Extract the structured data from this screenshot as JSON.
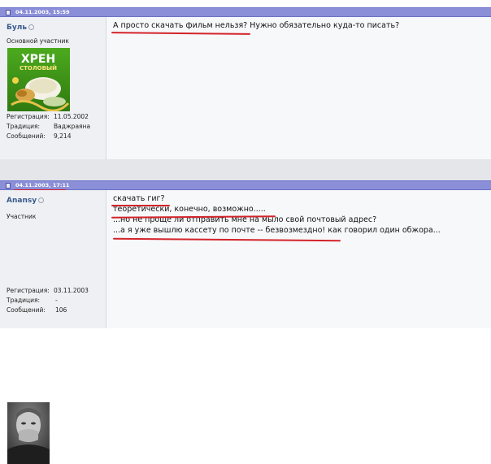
{
  "posts": [
    {
      "date": "04.11.2003, 15:59",
      "username": "Буль",
      "rank": "Основной участник",
      "avatar_text": [
        "ХРЕН",
        "СТОЛОВЫЙ"
      ],
      "meta": [
        {
          "label": "Регистрация:",
          "value": "11.05.2002"
        },
        {
          "label": "Традиция:",
          "value": "Ваджраяна"
        },
        {
          "label": "Сообщений:",
          "value": "9,214"
        }
      ],
      "message_lines": [
        {
          "underlined": "А просто скачать фильм нельзя?",
          "rest": " Нужно обязательно куда-то писать?"
        }
      ]
    },
    {
      "date": "04.11.2003, 17:11",
      "username": "Anansy",
      "rank": "Участник",
      "meta": [
        {
          "label": "Регистрация:",
          "value": "03.11.2003"
        },
        {
          "label": "Традиция:",
          "value": "-"
        },
        {
          "label": "Сообщений:",
          "value": "106"
        }
      ],
      "message_lines": [
        {
          "underlined": "скачать гиг?",
          "rest": ""
        },
        {
          "underlined": "теоретически, конечно, возможно.",
          "rest": "...."
        },
        {
          "underlined": "",
          "rest": "...но не проще ли отправить мне на мыло свой почтовый адрес?"
        },
        {
          "underlined": "...а я уже вышлю кассету по почте -- безвозмездно!",
          "rest": " как говорил один обжора..."
        }
      ]
    }
  ],
  "colors": {
    "header": "#8b8fd8",
    "annotation": "#d3242a",
    "username": "#3a5a8c"
  }
}
